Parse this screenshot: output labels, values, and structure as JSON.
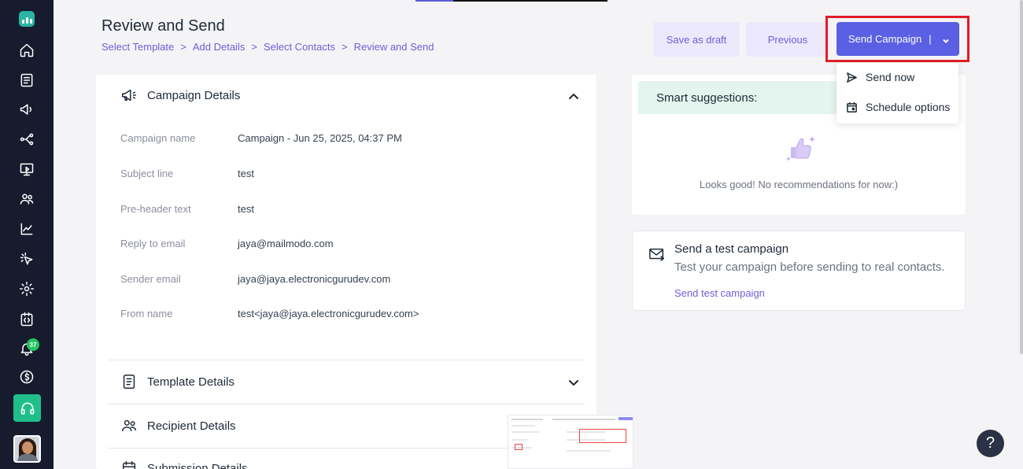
{
  "sidebar": {
    "notification_count": "37",
    "items": [
      "home-icon",
      "template-icon",
      "campaign-icon",
      "journey-icon",
      "landing-page-icon",
      "contacts-icon",
      "analytics-icon",
      "click-icon",
      "settings-icon",
      "code-icon",
      "bell-icon",
      "billing-icon"
    ]
  },
  "header": {
    "title": "Review and Send",
    "breadcrumb": [
      "Select Template",
      "Add Details",
      "Select Contacts",
      "Review and Send"
    ],
    "breadcrumb_separator": ">",
    "save_draft_label": "Save as draft",
    "previous_label": "Previous",
    "send_label": "Send Campaign",
    "send_separator": "|"
  },
  "dropdown": {
    "send_now_label": "Send now",
    "schedule_label": "Schedule options"
  },
  "campaign": {
    "section_title": "Campaign Details",
    "rows": [
      {
        "label": "Campaign name",
        "value": "Campaign - Jun 25, 2025, 04:37 PM"
      },
      {
        "label": "Subject line",
        "value": "test"
      },
      {
        "label": "Pre-header text",
        "value": "test"
      },
      {
        "label": "Reply to email",
        "value": "jaya@mailmodo.com"
      },
      {
        "label": "Sender email",
        "value": "jaya@jaya.electronicgurudev.com"
      },
      {
        "label": "From name",
        "value": "test<jaya@jaya.electronicgurudev.com>"
      }
    ],
    "template_title": "Template Details",
    "recipient_title": "Recipient Details",
    "submission_title": "Submission Details"
  },
  "smart": {
    "title": "Smart suggestions:",
    "empty_text": "Looks good! No recommendations for now:)"
  },
  "test_campaign": {
    "title": "Send a test campaign",
    "description": "Test your campaign before sending to real contacts.",
    "link_label": "Send test campaign"
  },
  "help_label": "?",
  "colors": {
    "sidebar_bg": "#161b2e",
    "accent": "#5b5fe3",
    "link": "#6d5fd8",
    "highlight": "#e11d28",
    "smart_bg": "#e3f5ee",
    "support": "#1fbf8a"
  }
}
